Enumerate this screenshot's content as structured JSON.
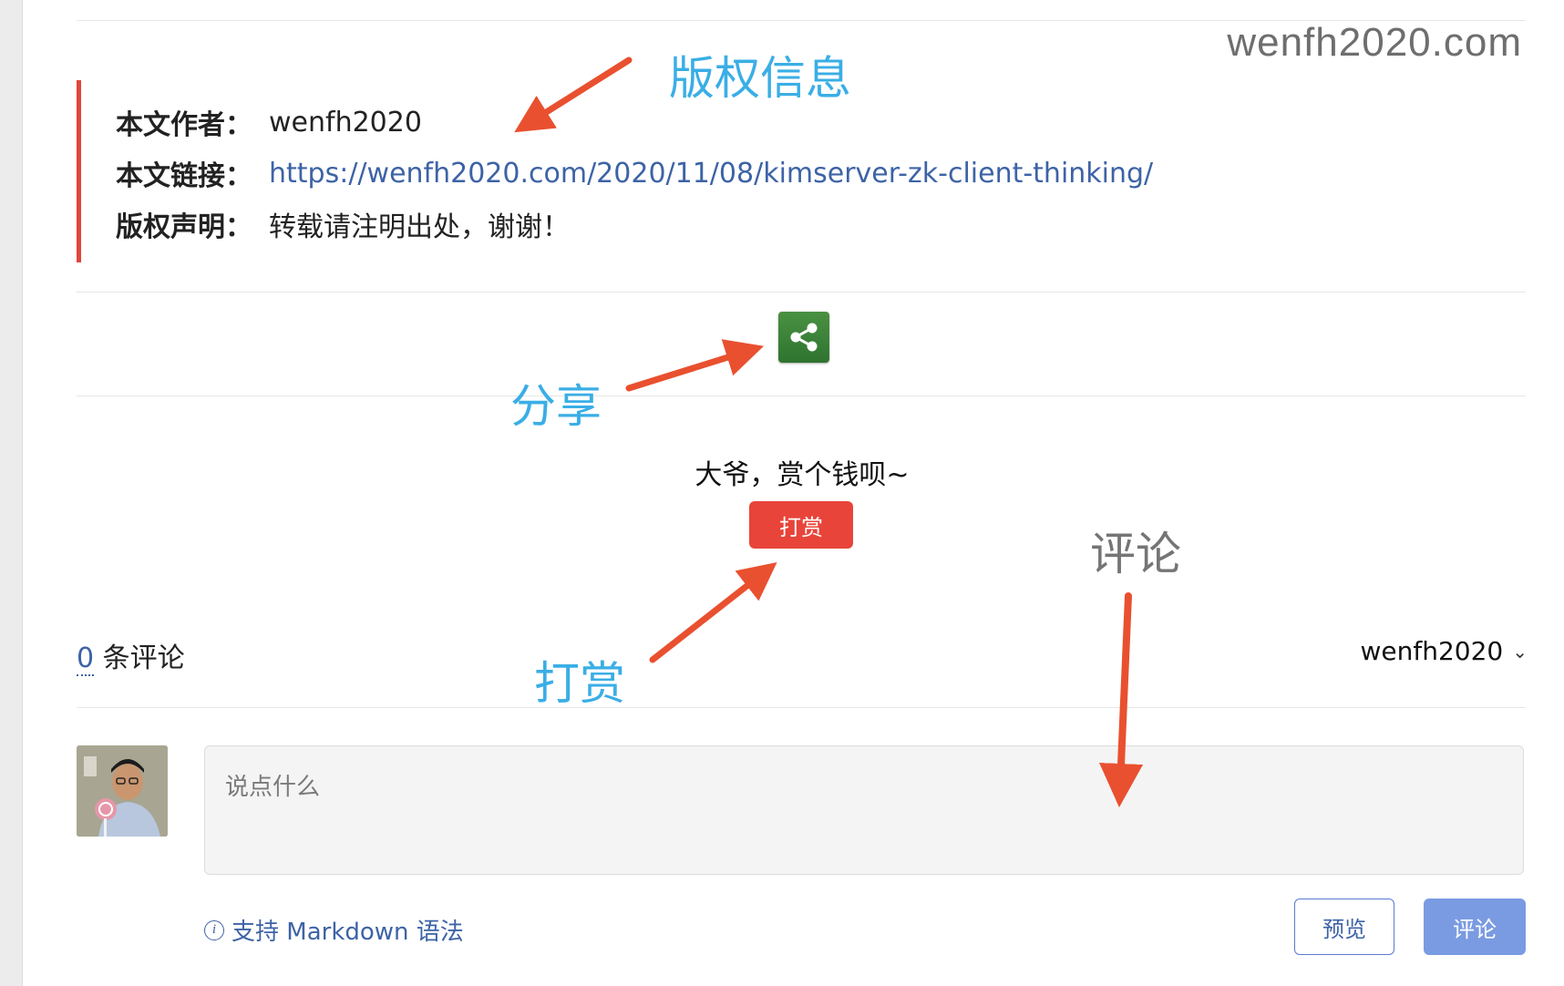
{
  "watermark": "wenfh2020.com",
  "copyright": {
    "author_label": "本文作者：",
    "author_value": "wenfh2020",
    "link_label": "本文链接：",
    "link_value": "https://wenfh2020.com/2020/11/08/kimserver-zk-client-thinking/",
    "notice_label": "版权声明：",
    "notice_value": "转载请注明出处，谢谢！"
  },
  "annotations": {
    "copyright": "版权信息",
    "share": "分享",
    "reward": "打赏",
    "comment": "评论",
    "colors": {
      "label_blue": "#3aaee6",
      "label_gray": "#757575",
      "arrow": "#e9502f"
    }
  },
  "share": {
    "icon": "share-icon"
  },
  "reward": {
    "text": "大爷，赏个钱呗~",
    "button_label": "打赏"
  },
  "comments": {
    "count": "0",
    "count_suffix": " 条评论",
    "user": "wenfh2020",
    "textarea_placeholder": "说点什么",
    "markdown_hint": "支持 Markdown 语法",
    "preview_label": "预览",
    "submit_label": "评论"
  }
}
